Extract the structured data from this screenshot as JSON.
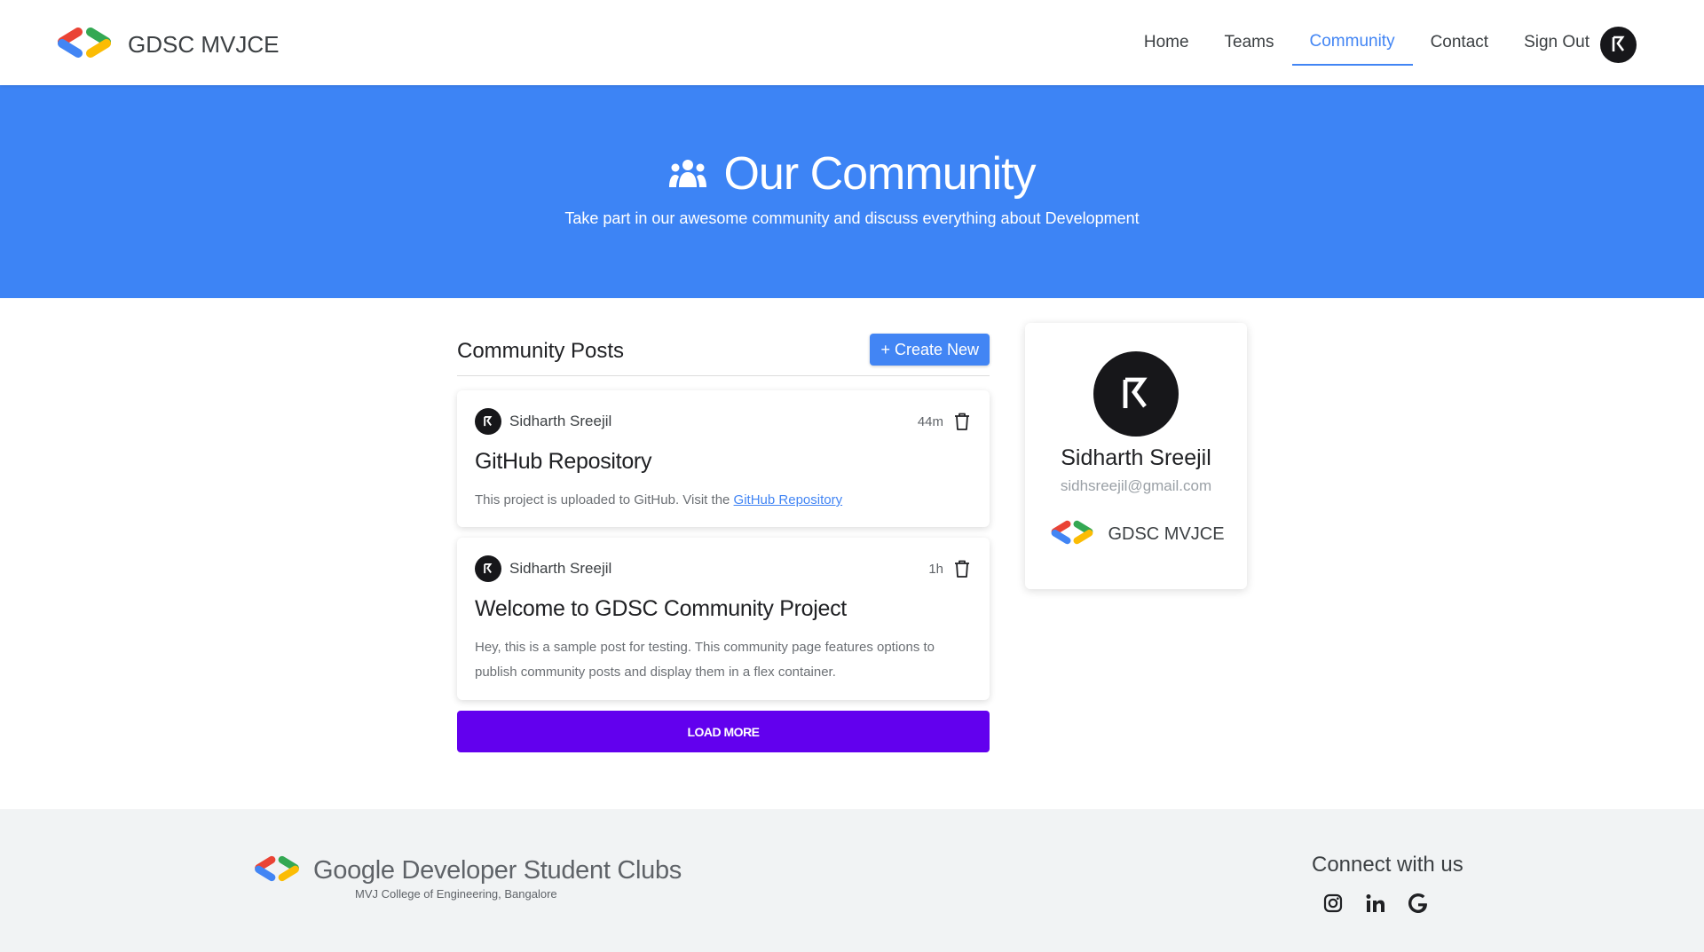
{
  "navbar": {
    "brand": "GDSC MVJCE",
    "links": [
      "Home",
      "Teams",
      "Community",
      "Contact",
      "Sign Out"
    ],
    "active_link": "Community"
  },
  "hero": {
    "title": "Our Community",
    "subtitle": "Take part in our awesome community and discuss everything about Development"
  },
  "posts": {
    "heading": "Community Posts",
    "create_label": "+ Create New",
    "items": [
      {
        "author": "Sidharth Sreejil",
        "time": "44m",
        "title": "GitHub Repository",
        "body": "This project is uploaded to GitHub. Visit the ",
        "link_text": "GitHub Repository"
      },
      {
        "author": "Sidharth Sreejil",
        "time": "1h",
        "title": "Welcome to GDSC Community Project",
        "body": "Hey, this is a sample post for testing. This community page features options to publish community posts and display them in a flex container."
      }
    ],
    "load_more_label": "LOAD MORE"
  },
  "profile": {
    "name": "Sidharth Sreejil",
    "email": "sidhsreejil@gmail.com",
    "club": "GDSC MVJCE"
  },
  "footer": {
    "brand": "Google Developer Student Clubs",
    "college": "MVJ College of Engineering, Bangalore",
    "connect_heading": "Connect with us",
    "socials": [
      "instagram-icon",
      "linkedin-icon",
      "google-icon"
    ]
  },
  "colors": {
    "accent": "#4285f4",
    "hero_bg": "#3d84f5",
    "load_more_bg": "#6200ee",
    "logo_red": "#ea4335",
    "logo_blue": "#4285f4",
    "logo_green": "#34a853",
    "logo_yellow": "#fbbc04"
  }
}
